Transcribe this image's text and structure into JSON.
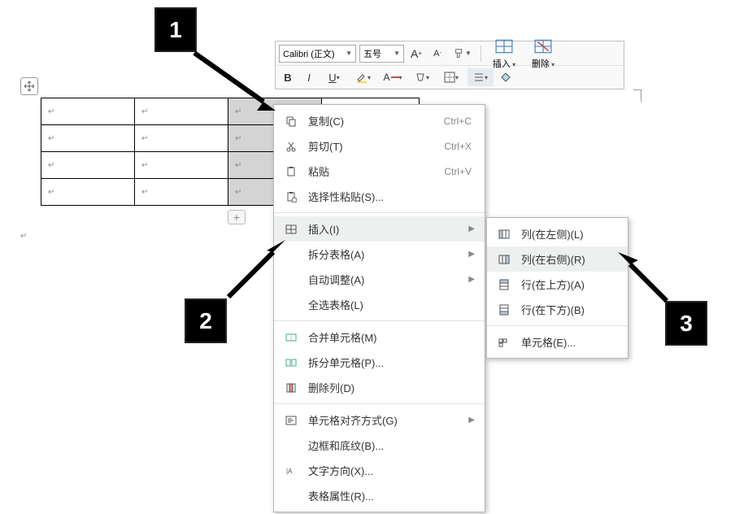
{
  "toolbar": {
    "font_name": "Calibri (正文)",
    "font_size": "五号",
    "increase_font": "A",
    "decrease_font": "A",
    "bold": "B",
    "italic": "I",
    "underline": "U",
    "insert_label": "插入",
    "delete_label": "删除"
  },
  "table": {
    "rows": 4,
    "cols": 4,
    "selected_col": 2
  },
  "context_menu": [
    {
      "icon": "copy",
      "label": "复制(C)",
      "shortcut": "Ctrl+C"
    },
    {
      "icon": "cut",
      "label": "剪切(T)",
      "shortcut": "Ctrl+X"
    },
    {
      "icon": "paste",
      "label": "粘贴",
      "shortcut": "Ctrl+V"
    },
    {
      "icon": "paste-special",
      "label": "选择性粘贴(S)..."
    },
    {
      "sep": true
    },
    {
      "icon": "insert",
      "label": "插入(I)",
      "sub": true,
      "highlight": true
    },
    {
      "label": "拆分表格(A)",
      "sub": true
    },
    {
      "label": "自动调整(A)",
      "sub": true
    },
    {
      "label": "全选表格(L)"
    },
    {
      "sep": true
    },
    {
      "icon": "merge",
      "label": "合并单元格(M)"
    },
    {
      "icon": "split",
      "label": "拆分单元格(P)..."
    },
    {
      "icon": "del-col",
      "label": "删除列(D)"
    },
    {
      "sep": true
    },
    {
      "icon": "align",
      "label": "单元格对齐方式(G)",
      "sub": true
    },
    {
      "label": "边框和底纹(B)..."
    },
    {
      "icon": "text-dir",
      "label": "文字方向(X)..."
    },
    {
      "label": "表格属性(R)..."
    }
  ],
  "submenu": [
    {
      "icon": "col-left",
      "label": "列(在左侧)(L)"
    },
    {
      "icon": "col-right",
      "label": "列(在右侧)(R)",
      "highlight": true
    },
    {
      "icon": "row-above",
      "label": "行(在上方)(A)"
    },
    {
      "icon": "row-below",
      "label": "行(在下方)(B)"
    },
    {
      "sep": true
    },
    {
      "icon": "cells",
      "label": "单元格(E)..."
    }
  ],
  "callouts": {
    "n1": "1",
    "n2": "2",
    "n3": "3"
  }
}
